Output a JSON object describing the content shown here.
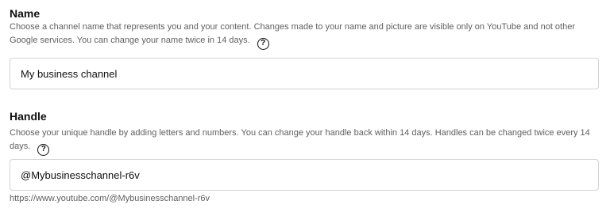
{
  "name_section": {
    "title": "Name",
    "description": "Choose a channel name that represents you and your content. Changes made to your name and picture are visible only on YouTube and not other Google services. You can change your name twice in 14 days.",
    "help_icon": "?",
    "input_value": "My business channel"
  },
  "handle_section": {
    "title": "Handle",
    "description": "Choose your unique handle by adding letters and numbers. You can change your handle back within 14 days. Handles can be changed twice every 14 days.",
    "help_icon": "?",
    "input_value": "@Mybusinesschannel-r6v",
    "channel_url": "https://www.youtube.com/@Mybusinesschannel-r6v"
  }
}
